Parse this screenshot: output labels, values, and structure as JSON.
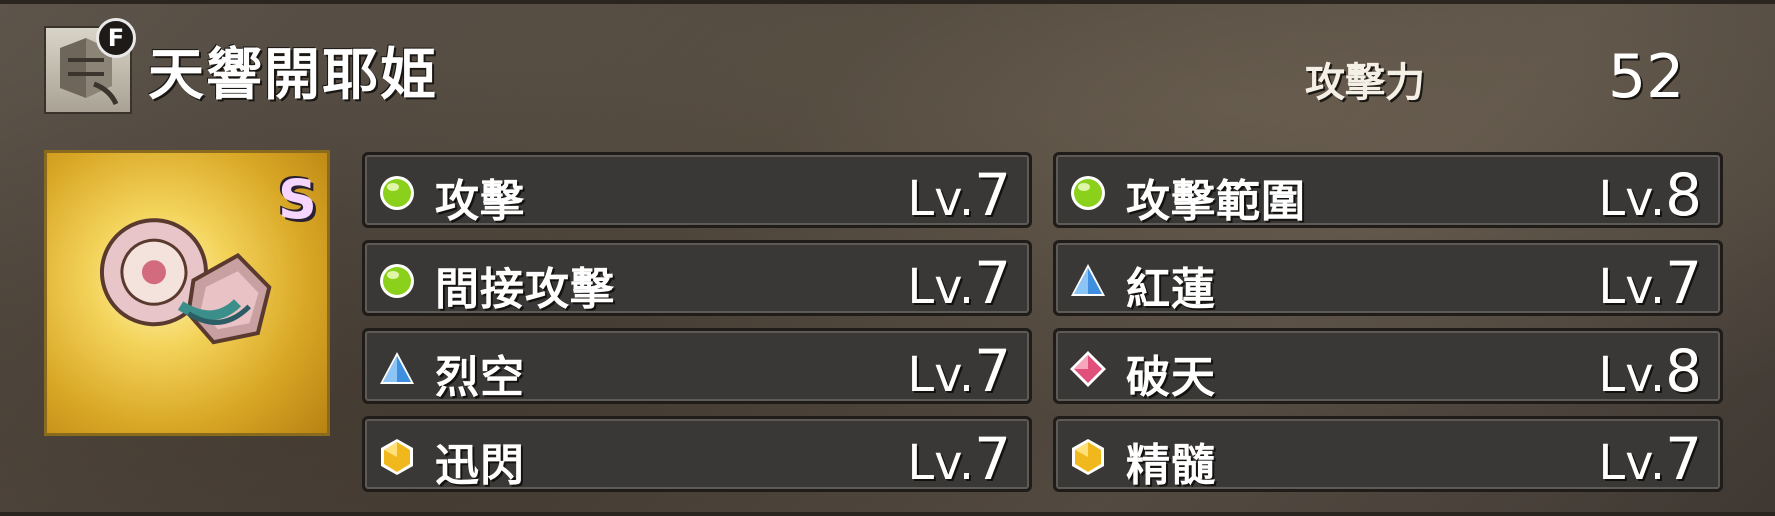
{
  "weapon": {
    "badge": "F",
    "name": "天響開耶姫",
    "icon": "hunting-horn-icon",
    "rarity_badge": "S",
    "card_icon": "weapon-artwork"
  },
  "attack": {
    "label": "攻擊力",
    "value": "52"
  },
  "skills": [
    {
      "name": "攻擊",
      "level_prefix": "Lv.",
      "level": "7",
      "icon": "green-orb-icon"
    },
    {
      "name": "攻擊範圍",
      "level_prefix": "Lv.",
      "level": "8",
      "icon": "green-orb-icon"
    },
    {
      "name": "間接攻擊",
      "level_prefix": "Lv.",
      "level": "7",
      "icon": "green-orb-icon"
    },
    {
      "name": "紅蓮",
      "level_prefix": "Lv.",
      "level": "7",
      "icon": "blue-pyramid-icon"
    },
    {
      "name": "烈空",
      "level_prefix": "Lv.",
      "level": "7",
      "icon": "blue-pyramid-icon"
    },
    {
      "name": "破天",
      "level_prefix": "Lv.",
      "level": "8",
      "icon": "pink-diamond-icon"
    },
    {
      "name": "迅閃",
      "level_prefix": "Lv.",
      "level": "7",
      "icon": "gold-hexagon-icon"
    },
    {
      "name": "精髓",
      "level_prefix": "Lv.",
      "level": "7",
      "icon": "gold-hexagon-icon"
    }
  ],
  "colors": {
    "green_orb": "#8bd11c",
    "blue_gem": "#3f8fe0",
    "pink_gem": "#e0507a",
    "gold_gem": "#f0b81c"
  }
}
